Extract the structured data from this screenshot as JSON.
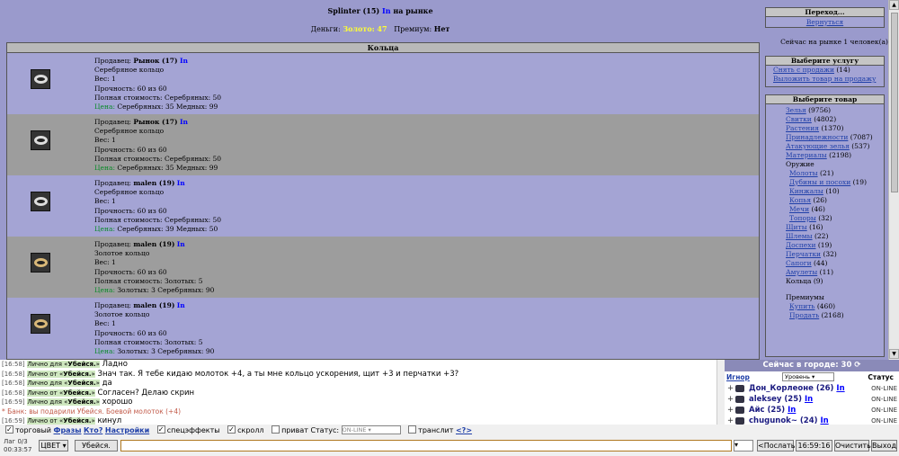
{
  "market": {
    "title_name": "Splinter (15)",
    "title_in": "In",
    "title_suffix": "на рынке",
    "money_label": "Деньги:",
    "money_value": "Золото: 47",
    "premium_label": "Премиум:",
    "premium_value": "Нет",
    "section_title": "Кольца",
    "lots": [
      {
        "seller_label": "Продавец:",
        "seller": "Рынок (17)",
        "in": "In",
        "item": "Серебряное кольцо",
        "weight": "Вес: 1",
        "durability": "Прочность: 60 из 60",
        "total": "Полная стоимость: Серебряных: 50",
        "price_label": "Цена:",
        "price": "Серебряных: 35 Медных: 99",
        "material": "silver"
      },
      {
        "seller_label": "Продавец:",
        "seller": "Рынок (17)",
        "in": "In",
        "item": "Серебряное кольцо",
        "weight": "Вес: 1",
        "durability": "Прочность: 60 из 60",
        "total": "Полная стоимость: Серебряных: 50",
        "price_label": "Цена:",
        "price": "Серебряных: 35 Медных: 99",
        "material": "silver"
      },
      {
        "seller_label": "Продавец:",
        "seller": "malen (19)",
        "in": "In",
        "item": "Серебряное кольцо",
        "weight": "Вес: 1",
        "durability": "Прочность: 60 из 60",
        "total": "Полная стоимость: Серебряных: 50",
        "price_label": "Цена:",
        "price": "Серебряных: 39 Медных: 50",
        "material": "silver"
      },
      {
        "seller_label": "Продавец:",
        "seller": "malen (19)",
        "in": "In",
        "item": "Золотое кольцо",
        "weight": "Вес: 1",
        "durability": "Прочность: 60 из 60",
        "total": "Полная стоимость: Золотых: 5",
        "price_label": "Цена:",
        "price": "Золотых: 3 Серебряных: 90",
        "material": "gold"
      },
      {
        "seller_label": "Продавец:",
        "seller": "malen (19)",
        "in": "In",
        "item": "Золотое кольцо",
        "weight": "Вес: 1",
        "durability": "Прочность: 60 из 60",
        "total": "Полная стоимость: Золотых: 5",
        "price_label": "Цена:",
        "price": "Золотых: 3 Серебряных: 90",
        "material": "gold"
      }
    ]
  },
  "right": {
    "go_title": "Переход...",
    "go_link": "Вернуться",
    "online_text": "Сейчас на рынке 1 человек(а)",
    "service_title": "Выберите услугу",
    "services": [
      "Снять с продажи",
      "(14)",
      "Выложить товар на продажу"
    ],
    "goods_title": "Выберите товар",
    "goods": [
      {
        "label": "Зелья",
        "count": "(9756)"
      },
      {
        "label": "Свитки",
        "count": "(4802)"
      },
      {
        "label": "Растения",
        "count": "(1370)"
      },
      {
        "label": "Принадлежности",
        "count": "(7087)"
      },
      {
        "label": "Атакующие зелья",
        "count": "(537)"
      },
      {
        "label": "Материалы",
        "count": "(2198)"
      }
    ],
    "weapons_label": "Оружие",
    "weapons": [
      {
        "label": "Молоты",
        "count": "(21)"
      },
      {
        "label": "Дубины и посохи",
        "count": "(19)"
      },
      {
        "label": "Кинжалы",
        "count": "(10)"
      },
      {
        "label": "Копья",
        "count": "(26)"
      },
      {
        "label": "Мечи",
        "count": "(46)"
      },
      {
        "label": "Топоры",
        "count": "(32)"
      }
    ],
    "armor": [
      {
        "label": "Щиты",
        "count": "(16)"
      },
      {
        "label": "Шлемы",
        "count": "(22)"
      },
      {
        "label": "Доспехи",
        "count": "(19)"
      },
      {
        "label": "Перчатки",
        "count": "(32)"
      },
      {
        "label": "Сапоги",
        "count": "(44)"
      },
      {
        "label": "Амулеты",
        "count": "(11)"
      }
    ],
    "rings_label": "Кольца (9)",
    "premium_label": "Премиумы",
    "premium_items": [
      {
        "label": "Купить",
        "count": "(460)"
      },
      {
        "label": "Продать",
        "count": "(2168)"
      }
    ]
  },
  "chat": {
    "lines": [
      {
        "time": "[16:58]",
        "tag": "Лично для «",
        "nick": "Убейся.",
        "tag_end": "»",
        "text": " Ладно"
      },
      {
        "time": "[16:58]",
        "tag": "Лично от «",
        "nick": "Убейся.",
        "tag_end": "»",
        "text": " Знач так. Я тебе кидаю молоток +4, а ты мне кольцо ускорения, щит +3 и перчатки +3?"
      },
      {
        "time": "[16:58]",
        "tag": "Лично для «",
        "nick": "Убейся.",
        "tag_end": "»",
        "text": " да"
      },
      {
        "time": "[16:58]",
        "tag": "Лично от «",
        "nick": "Убейся.",
        "tag_end": "»",
        "text": " Согласен? Делаю скрин"
      },
      {
        "time": "[16:59]",
        "tag": "Лично для «",
        "nick": "Убейся.",
        "tag_end": "»",
        "text": " хорошо"
      },
      {
        "time": "",
        "tag": "",
        "nick": "",
        "tag_end": "",
        "text": "* Банк: вы подарили Убейся. Боевой молоток (+4)"
      },
      {
        "time": "[16:59]",
        "tag": "Лично от «",
        "nick": "Убейся.",
        "tag_end": "»",
        "text": " кинул"
      }
    ]
  },
  "who": {
    "header": "Сейчас в городе: 30",
    "ignore": "Игнор",
    "level_select": "Уровень",
    "status_col": "Статус",
    "rows": [
      {
        "name": "Дон_Корлеоне (26)",
        "in": "In",
        "status": "ON-LINE"
      },
      {
        "name": "aleksey (25)",
        "in": "In",
        "status": "ON-LINE"
      },
      {
        "name": "Айс (25)",
        "in": "In",
        "status": "ON-LINE"
      },
      {
        "name": "chugunok~ (24)",
        "in": "In",
        "status": "ON-LINE"
      }
    ]
  },
  "controls": {
    "trade": "торговый",
    "phrases": "Фразы",
    "who": "Кто?",
    "settings": "Настройки",
    "effects": "спецэффекты",
    "scroll": "скролл",
    "private": "приват",
    "status_label": "Статус:",
    "status_value": "ON-LINE",
    "translit": "транслит",
    "translit_link": "<?>"
  },
  "inputbar": {
    "lag": "Лаг 0/3",
    "clock_small": "00:33:57",
    "color_btn": "ЦВЕТ",
    "nick_btn": "Убейся.",
    "send_btn": "<Послать",
    "time_btn": "16:59:16",
    "clear_btn": "Очистить",
    "exit_btn": "Выход"
  }
}
